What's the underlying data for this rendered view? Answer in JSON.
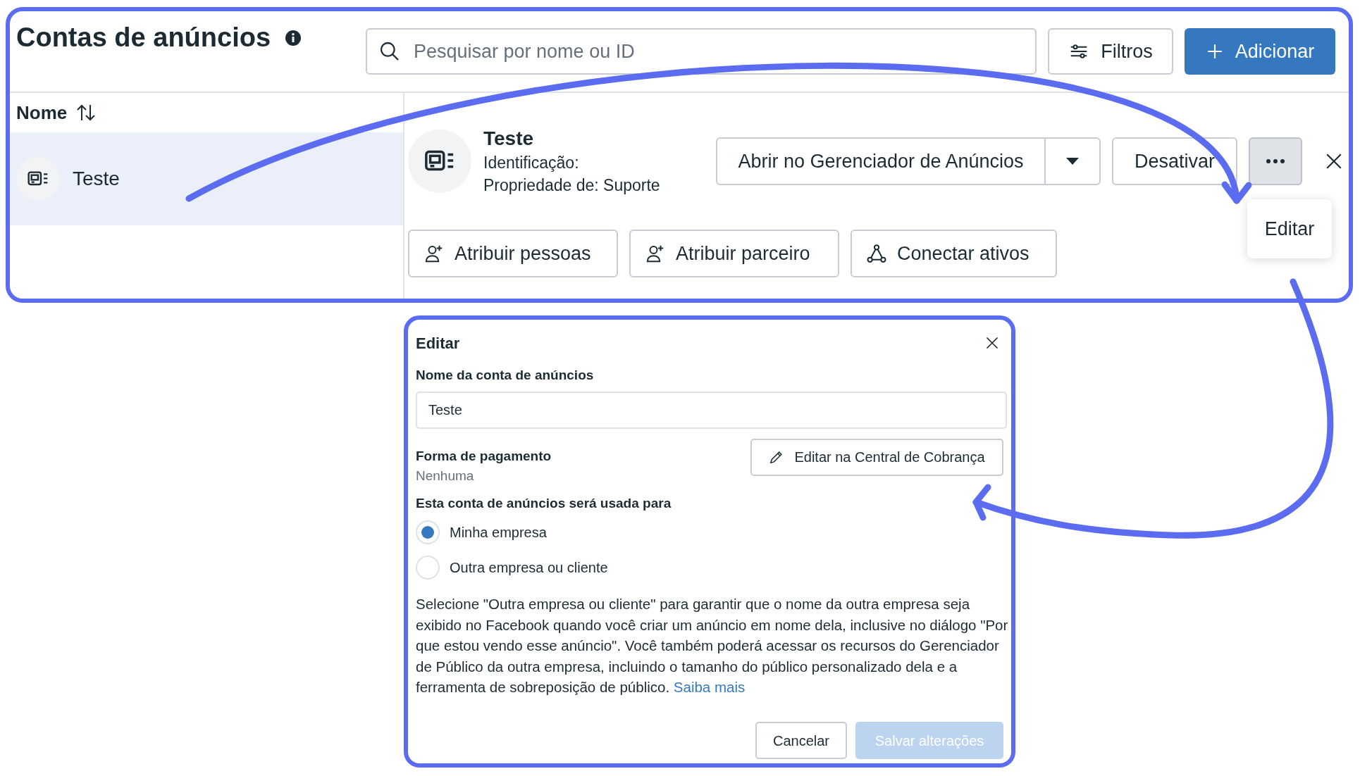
{
  "header": {
    "title": "Contas de anúncios",
    "search": {
      "placeholder": "Pesquisar por nome ou ID"
    },
    "buttons": [
      {
        "label": "Filtros",
        "kind": "filter"
      },
      {
        "label": "Adicionar",
        "kind": "add"
      }
    ]
  },
  "list": {
    "column": "Nome",
    "rows": [
      {
        "name": "Teste",
        "selected": true
      }
    ]
  },
  "detail": {
    "name": "Teste",
    "id_label": "Identificação:",
    "owner": "Propriedade de: Suporte",
    "primary_action": "Abrir no Gerenciador de Anúncios",
    "secondary_action": "Desativar",
    "menu": [
      {
        "label": "Editar"
      }
    ],
    "assign_buttons": [
      {
        "label": "Atribuir pessoas",
        "kind": "person"
      },
      {
        "label": "Atribuir parceiro",
        "kind": "person"
      },
      {
        "label": "Conectar ativos",
        "kind": "nodes"
      }
    ]
  },
  "dialog": {
    "title": "Editar",
    "name_label": "Nome da conta de anúncios",
    "name_value": "Teste",
    "payment_label": "Forma de pagamento",
    "payment_value": "Nenhuma",
    "billing_button": "Editar na Central de Cobrança",
    "usage_label": "Esta conta de anúncios será usada para",
    "options": [
      {
        "label": "Minha empresa",
        "selected": true
      },
      {
        "label": "Outra empresa ou cliente",
        "selected": false
      }
    ],
    "help": "Selecione \"Outra empresa ou cliente\" para garantir que o nome da outra empresa seja exibido no Facebook quando você criar um anúncio em nome dela, inclusive no diálogo \"Por que estou vendo esse anúncio\". Você também poderá acessar os recursos do Gerenciador de Público da outra empresa, incluindo o tamanho do público personalizado dela e a ferramenta de sobreposição de público.",
    "help_link": "Saiba mais",
    "buttons": [
      {
        "label": "Cancelar",
        "kind": "secondary",
        "disabled": false
      },
      {
        "label": "Salvar alterações",
        "kind": "primary",
        "disabled": true
      }
    ]
  }
}
